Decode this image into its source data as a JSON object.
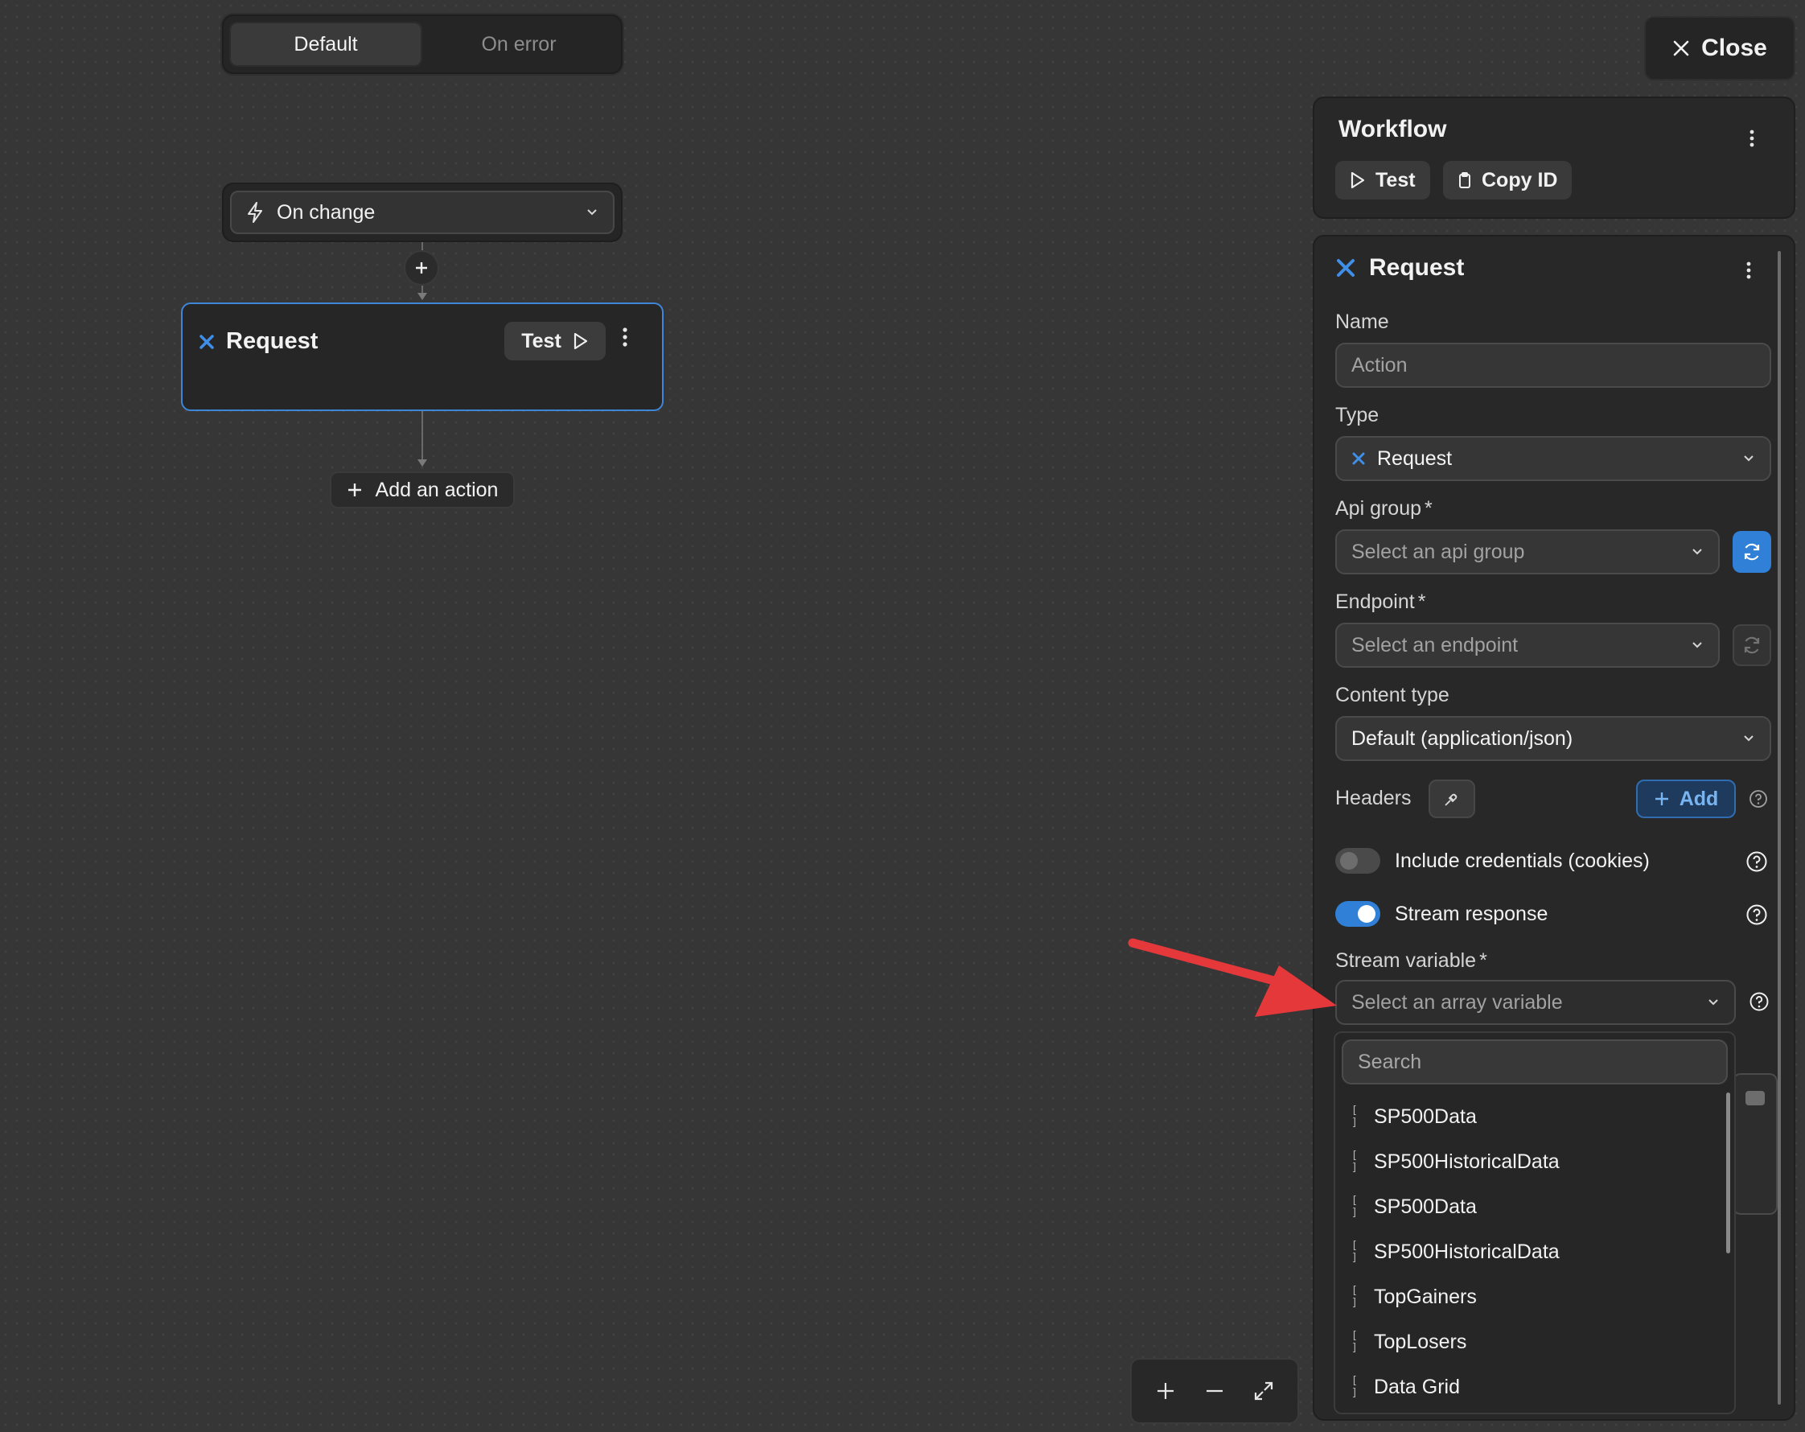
{
  "mode_toggle": {
    "default": "Default",
    "on_error": "On error"
  },
  "trigger": {
    "label": "On change"
  },
  "request_node": {
    "title": "Request",
    "test_label": "Test"
  },
  "add_action": {
    "label": "Add an action"
  },
  "close": {
    "label": "Close"
  },
  "workflow": {
    "title": "Workflow",
    "test_label": "Test",
    "copy_id_label": "Copy ID"
  },
  "panel": {
    "title": "Request",
    "name": {
      "label": "Name",
      "placeholder": "Action"
    },
    "type": {
      "label": "Type",
      "value": "Request"
    },
    "api_group": {
      "label": "Api group",
      "required": "*",
      "placeholder": "Select an api group"
    },
    "endpoint": {
      "label": "Endpoint",
      "required": "*",
      "placeholder": "Select an endpoint"
    },
    "content_type": {
      "label": "Content type",
      "value": "Default (application/json)"
    },
    "headers": {
      "label": "Headers",
      "add_label": "Add"
    },
    "include_credentials": {
      "label": "Include credentials (cookies)",
      "on": false
    },
    "stream_response": {
      "label": "Stream response",
      "on": true
    },
    "stream_variable": {
      "label": "Stream variable",
      "required": "*",
      "placeholder": "Select an array variable"
    }
  },
  "dropdown": {
    "search_placeholder": "Search",
    "bracket": "[ ]",
    "options": [
      "SP500Data",
      "SP500HistoricalData",
      "SP500Data",
      "SP500HistoricalData",
      "TopGainers",
      "TopLosers",
      "Data Grid"
    ]
  },
  "colors": {
    "accent": "#2f80d6",
    "node_border": "#3f86d8",
    "arrow": "#e5383b",
    "background": "#363636"
  }
}
